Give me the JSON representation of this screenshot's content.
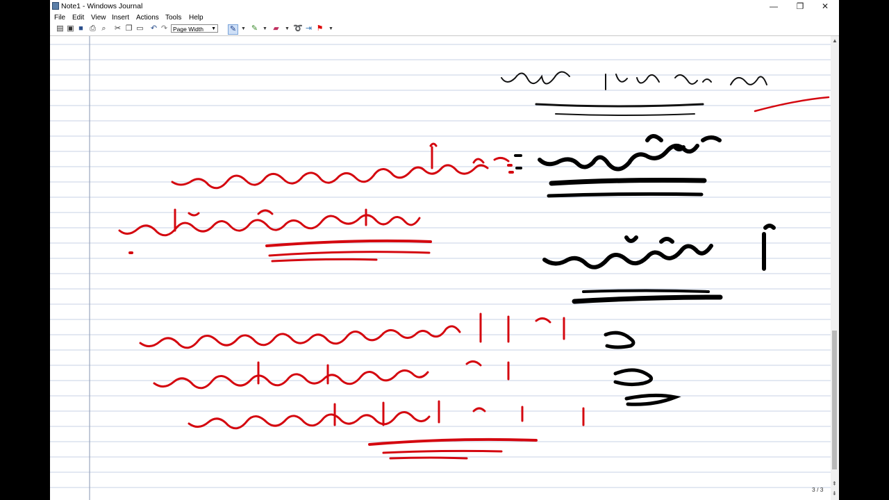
{
  "window": {
    "title": "Note1 - Windows Journal"
  },
  "window_buttons": {
    "minimize": "—",
    "maximize": "❐",
    "close": "✕"
  },
  "menu": [
    "File",
    "Edit",
    "View",
    "Insert",
    "Actions",
    "Tools",
    "Help"
  ],
  "toolbar": {
    "zoom_value": "Page Width",
    "icons": [
      "new-note-icon",
      "open-icon",
      "save-icon",
      "print-icon",
      "find-icon",
      "cut-icon",
      "copy-icon",
      "paste-icon",
      "undo-icon",
      "redo-icon",
      "pen-icon",
      "highlighter-icon",
      "eraser-icon",
      "lasso-icon",
      "insert-space-icon",
      "flag-icon"
    ]
  },
  "colors": {
    "ink_red": "#d4070f",
    "ink_black": "#000000",
    "rule_line": "#c7d2e6",
    "margin_line": "#9aa6bd"
  },
  "status": {
    "page_indicator": "3 / 3"
  },
  "page_content": {
    "type": "handwritten Arabic notes",
    "inks": [
      "black",
      "red"
    ]
  }
}
